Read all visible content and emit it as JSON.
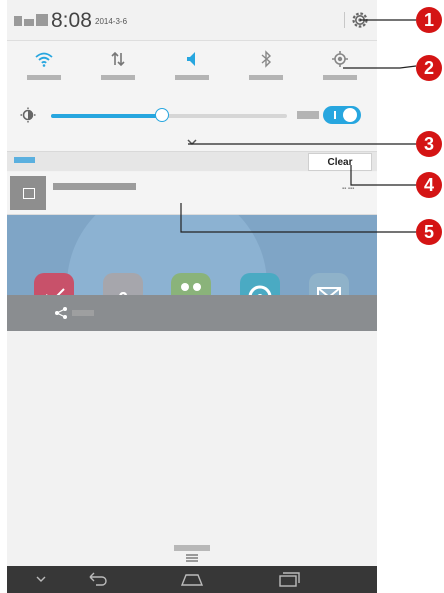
{
  "status_bar": {
    "time": "8:08",
    "date": "2014-3-6",
    "settings_icon": "gear-icon"
  },
  "quick_toggles": [
    {
      "name": "wifi",
      "icon": "wifi-icon",
      "active": true
    },
    {
      "name": "mobile-data",
      "icon": "data-arrows-icon",
      "active": false
    },
    {
      "name": "sound",
      "icon": "speaker-icon",
      "active": true
    },
    {
      "name": "bluetooth",
      "icon": "bluetooth-icon",
      "active": false
    },
    {
      "name": "location",
      "icon": "location-icon",
      "active": false
    }
  ],
  "brightness": {
    "level": 0.47,
    "auto_enabled": true
  },
  "notifications": {
    "clear_label": "Clear",
    "items": [
      {
        "icon": "image-icon"
      }
    ]
  },
  "share_bar": {
    "icon": "share-icon"
  },
  "navigation": {
    "buttons": [
      "down-icon",
      "back-icon",
      "home-icon",
      "recent-apps-icon"
    ]
  },
  "callouts": [
    "1",
    "2",
    "3",
    "4",
    "5"
  ],
  "colors": {
    "accent": "#27a6df",
    "callout": "#d41414",
    "nav_bar": "#373737"
  }
}
